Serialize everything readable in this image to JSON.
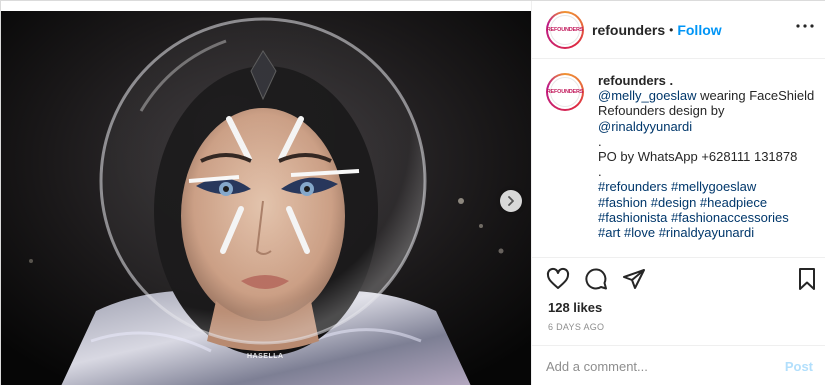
{
  "header": {
    "username": "refounders",
    "separator": "•",
    "follow_label": "Follow",
    "avatar_text": "REFOUNDERS"
  },
  "caption": {
    "username": "refounders .",
    "lines": [
      {
        "mention": "@melly_goeslaw",
        "text": " wearing FaceShield"
      },
      {
        "text": "Refounders design by"
      },
      {
        "mention": "@rinaldyyunardi"
      },
      {
        "text": "."
      },
      {
        "text": "PO by WhatsApp +628111 131878"
      },
      {
        "text": "."
      },
      {
        "tags": "#refounders #mellygoeslaw"
      },
      {
        "tags": "#fashion #design #headpiece"
      },
      {
        "tags": "#fashionista #fashionaccessories"
      },
      {
        "tags": "#art #love #rinaldyayunardi"
      }
    ]
  },
  "actions": {
    "like_icon": "heart-icon",
    "comment_icon": "comment-icon",
    "share_icon": "share-icon",
    "save_icon": "bookmark-icon"
  },
  "likes": "128 likes",
  "date": "6 DAYS AGO",
  "comment": {
    "placeholder": "Add a comment...",
    "post_label": "Post"
  },
  "photo": {
    "watermark": "HASELLA"
  },
  "colors": {
    "link": "#0095f6",
    "hashtag": "#00376b",
    "muted": "#8e8e8e",
    "post_disabled": "#b2dffc"
  }
}
